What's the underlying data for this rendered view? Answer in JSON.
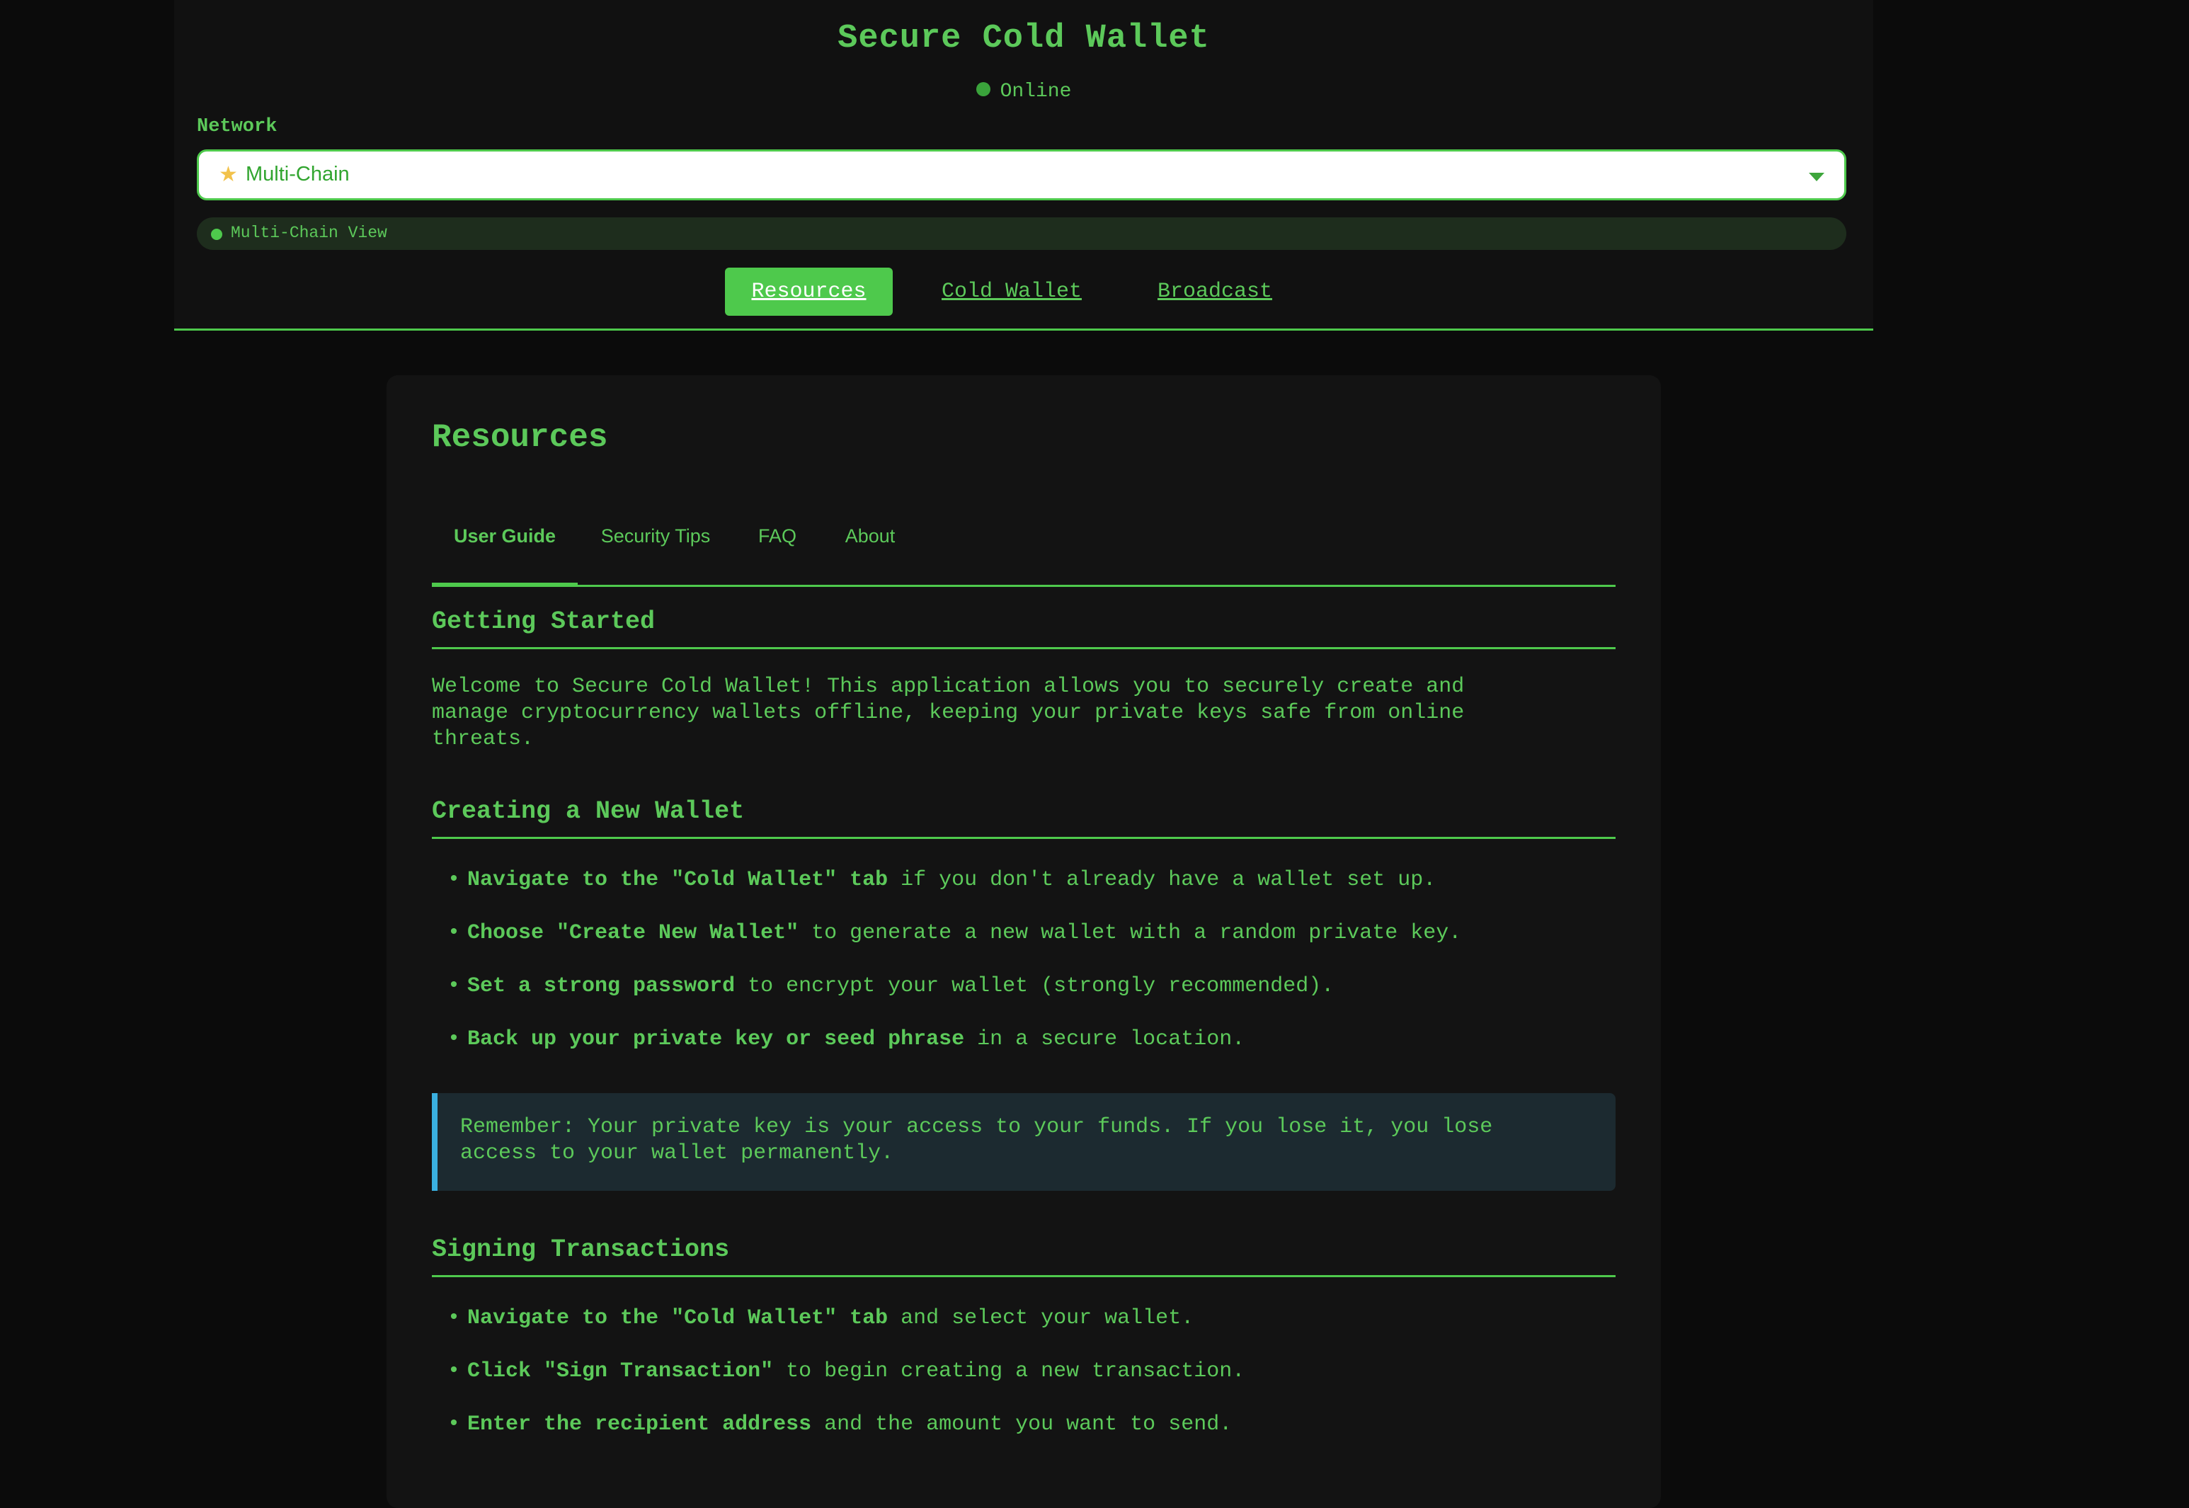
{
  "app": {
    "title": "Secure Cold Wallet",
    "status": "Online"
  },
  "network": {
    "label": "Network",
    "icon": "star-icon",
    "selected": "Multi-Chain",
    "view_label": "Multi-Chain View"
  },
  "nav": {
    "items": [
      "Resources",
      "Cold Wallet",
      "Broadcast"
    ],
    "active": "Resources"
  },
  "resources": {
    "title": "Resources",
    "tabs": [
      "User Guide",
      "Security Tips",
      "FAQ",
      "About"
    ],
    "active_tab": "User Guide",
    "sections": {
      "getting_started": {
        "heading": "Getting Started",
        "lines": [
          "Welcome to Secure Cold Wallet! This application allows you to securely create and",
          "manage cryptocurrency wallets offline, keeping your private keys safe from online",
          "threats."
        ]
      },
      "creating": {
        "heading": "Creating a New Wallet",
        "items": [
          {
            "bold": "Navigate to the \"Cold Wallet\" tab",
            "rest": " if you don't already have a wallet set up."
          },
          {
            "bold": "Choose \"Create New Wallet\"",
            "rest": " to generate a new wallet with a random private key."
          },
          {
            "bold": "Set a strong password",
            "rest": " to encrypt your wallet (strongly recommended)."
          },
          {
            "bold": "Back up your private key or seed phrase",
            "rest": " in a secure location."
          }
        ],
        "note_lines": [
          "Remember: Your private key is your access to your funds. If you lose it, you lose",
          "access to your wallet permanently."
        ]
      },
      "signing": {
        "heading": "Signing Transactions",
        "items": [
          {
            "bold": "Navigate to the \"Cold Wallet\" tab",
            "rest": " and select your wallet."
          },
          {
            "bold": "Click \"Sign Transaction\"",
            "rest": " to begin creating a new transaction."
          },
          {
            "bold": "Enter the recipient address",
            "rest": " and the amount you want to send."
          }
        ]
      }
    }
  },
  "colors": {
    "accent": "#4ec94c",
    "text": "#5cc95a",
    "note_border": "#3ab0e0"
  }
}
